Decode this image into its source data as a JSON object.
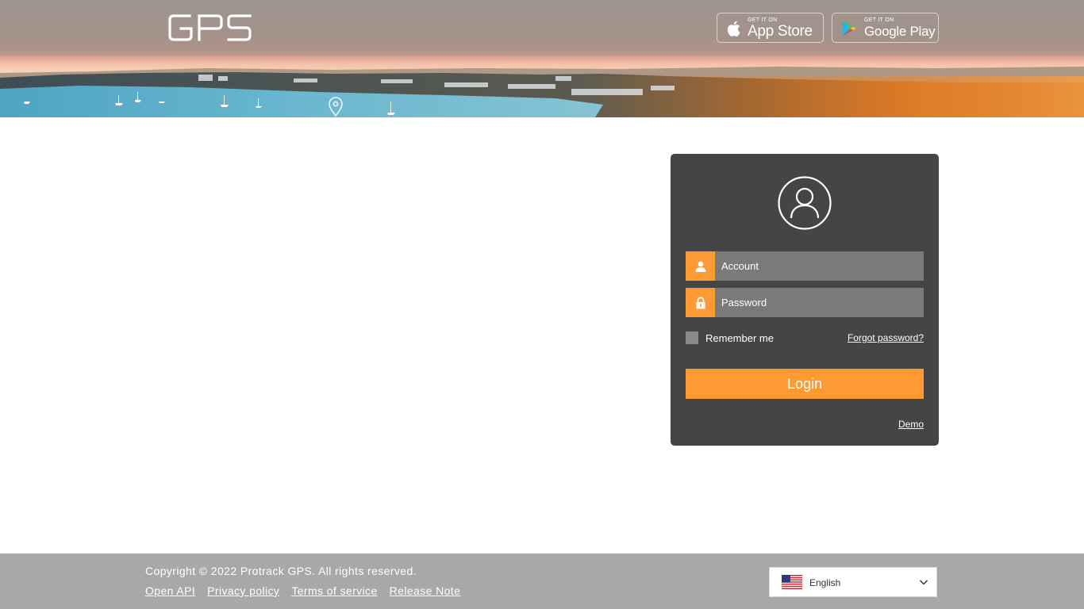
{
  "header": {
    "logo_text": "GPS",
    "app_store": {
      "small": "GET IT ON",
      "big": "App Store"
    },
    "google_play": {
      "small": "GET IT ON",
      "big": "Google Play"
    }
  },
  "login": {
    "account_placeholder": "Account",
    "password_placeholder": "Password",
    "remember_label": "Remember me",
    "forgot_label": "Forgot password?",
    "login_label": "Login",
    "demo_label": "Demo"
  },
  "footer": {
    "copyright": "Copyright © 2022 Protrack GPS. All rights reserved.",
    "links": [
      "Open API",
      "Privacy policy",
      "Terms of service",
      "Release Note"
    ],
    "language": "English"
  },
  "colors": {
    "accent": "#fd9a33",
    "card": "#454545",
    "field": "#7a7a7a",
    "footer": "#a8a8a8"
  }
}
